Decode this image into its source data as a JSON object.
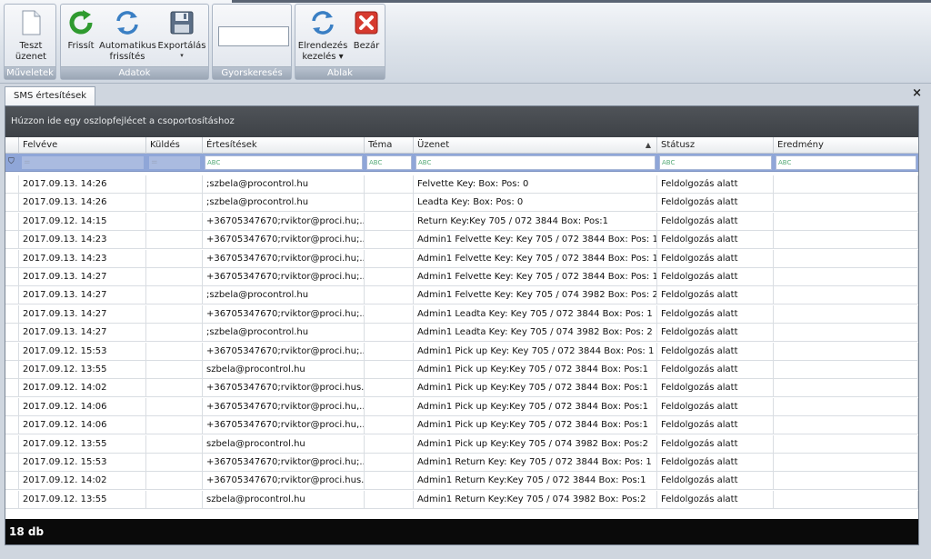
{
  "ribbon": {
    "groups": [
      {
        "label": "Műveletek",
        "buttons": [
          {
            "label_1": "Teszt",
            "label_2": "üzenet",
            "icon": "document-icon"
          }
        ]
      },
      {
        "label": "Adatok",
        "buttons": [
          {
            "label_1": "Frissít",
            "label_2": "",
            "icon": "refresh-icon"
          },
          {
            "label_1": "Automatikus",
            "label_2": "frissítés",
            "icon": "auto-refresh-icon"
          },
          {
            "label_1": "Exportálás",
            "label_2": "▾",
            "icon": "floppy-disk-icon"
          }
        ]
      },
      {
        "label": "Gyorskeresés",
        "search_value": ""
      },
      {
        "label": "Ablak",
        "buttons": [
          {
            "label_1": "Elrendezés",
            "label_2": "kezelés ▾",
            "icon": "layout-icon"
          },
          {
            "label_1": "Bezár",
            "label_2": "",
            "icon": "close-red-icon"
          }
        ]
      }
    ]
  },
  "tabs": [
    {
      "label": "SMS értesítések"
    }
  ],
  "tab_close": "×",
  "grid": {
    "group_panel_text": "Húzzon ide egy oszlopfejlécet a csoportosításhoz",
    "columns": [
      "Felvéve",
      "Küldés",
      "Értesítések",
      "Téma",
      "Üzenet",
      "Státusz",
      "Eredmény"
    ],
    "sort_indicator": "▲",
    "filter_row": {
      "Felvéve": "=",
      "Küldés": "=",
      "Értesítések": "ABC",
      "Téma": "ABC",
      "Üzenet": "ABC",
      "Státusz": "ABC",
      "Eredmény": "ABC"
    },
    "rows": [
      {
        "felveve": "2017.09.13. 14:26",
        "kuldes": "",
        "ertesitesek": ";szbela@procontrol.hu",
        "tema": "",
        "uzenet": "Felvette Key:  Box:  Pos: 0",
        "statusz": "Feldolgozás alatt",
        "eredmeny": ""
      },
      {
        "felveve": "2017.09.13. 14:26",
        "kuldes": "",
        "ertesitesek": ";szbela@procontrol.hu",
        "tema": "",
        "uzenet": "Leadta Key:  Box:  Pos: 0",
        "statusz": "Feldolgozás alatt",
        "eredmeny": ""
      },
      {
        "felveve": "2017.09.12. 14:15",
        "kuldes": "",
        "ertesitesek": "+36705347670;rviktor@proci.hu;...",
        "tema": "",
        "uzenet": "Return Key:Key 705 / 072 3844 Box: Pos:1",
        "statusz": "Feldolgozás alatt",
        "eredmeny": ""
      },
      {
        "felveve": "2017.09.13. 14:23",
        "kuldes": "",
        "ertesitesek": "+36705347670;rviktor@proci.hu;...",
        "tema": "",
        "uzenet": "Admin1 Felvette Key: Key 705 / 072 3844 Box:  Pos: 1",
        "statusz": "Feldolgozás alatt",
        "eredmeny": ""
      },
      {
        "felveve": "2017.09.13. 14:23",
        "kuldes": "",
        "ertesitesek": "+36705347670;rviktor@proci.hu;...",
        "tema": "",
        "uzenet": "Admin1 Felvette Key: Key 705 / 072 3844 Box:  Pos: 1",
        "statusz": "Feldolgozás alatt",
        "eredmeny": ""
      },
      {
        "felveve": "2017.09.13. 14:27",
        "kuldes": "",
        "ertesitesek": "+36705347670;rviktor@proci.hu;...",
        "tema": "",
        "uzenet": "Admin1 Felvette Key: Key 705 / 072 3844 Box:  Pos: 1",
        "statusz": "Feldolgozás alatt",
        "eredmeny": ""
      },
      {
        "felveve": "2017.09.13. 14:27",
        "kuldes": "",
        "ertesitesek": ";szbela@procontrol.hu",
        "tema": "",
        "uzenet": "Admin1 Felvette Key: Key 705 / 074 3982 Box:  Pos: 2",
        "statusz": "Feldolgozás alatt",
        "eredmeny": ""
      },
      {
        "felveve": "2017.09.13. 14:27",
        "kuldes": "",
        "ertesitesek": "+36705347670;rviktor@proci.hu;...",
        "tema": "",
        "uzenet": "Admin1 Leadta Key: Key 705 / 072 3844 Box:  Pos: 1",
        "statusz": "Feldolgozás alatt",
        "eredmeny": ""
      },
      {
        "felveve": "2017.09.13. 14:27",
        "kuldes": "",
        "ertesitesek": ";szbela@procontrol.hu",
        "tema": "",
        "uzenet": "Admin1 Leadta Key: Key 705 / 074 3982 Box:  Pos: 2",
        "statusz": "Feldolgozás alatt",
        "eredmeny": ""
      },
      {
        "felveve": "2017.09.12. 15:53",
        "kuldes": "",
        "ertesitesek": "+36705347670;rviktor@proci.hu;...",
        "tema": "",
        "uzenet": "Admin1 Pick up Key: Key 705 / 072 3844 Box:  Pos: 1",
        "statusz": "Feldolgozás alatt",
        "eredmeny": ""
      },
      {
        "felveve": "2017.09.12. 13:55",
        "kuldes": "",
        "ertesitesek": "szbela@procontrol.hu",
        "tema": "",
        "uzenet": "Admin1 Pick up Key:Key 705 / 072 3844 Box: Pos:1",
        "statusz": "Feldolgozás alatt",
        "eredmeny": ""
      },
      {
        "felveve": "2017.09.12. 14:02",
        "kuldes": "",
        "ertesitesek": "+36705347670;rviktor@proci.hus...",
        "tema": "",
        "uzenet": "Admin1 Pick up Key:Key 705 / 072 3844 Box: Pos:1",
        "statusz": "Feldolgozás alatt",
        "eredmeny": ""
      },
      {
        "felveve": "2017.09.12. 14:06",
        "kuldes": "",
        "ertesitesek": "+36705347670;rviktor@proci.hu,...",
        "tema": "",
        "uzenet": "Admin1 Pick up Key:Key 705 / 072 3844 Box: Pos:1",
        "statusz": "Feldolgozás alatt",
        "eredmeny": ""
      },
      {
        "felveve": "2017.09.12. 14:06",
        "kuldes": "",
        "ertesitesek": "+36705347670;rviktor@proci.hu,...",
        "tema": "",
        "uzenet": "Admin1 Pick up Key:Key 705 / 072 3844 Box: Pos:1",
        "statusz": "Feldolgozás alatt",
        "eredmeny": ""
      },
      {
        "felveve": "2017.09.12. 13:55",
        "kuldes": "",
        "ertesitesek": "szbela@procontrol.hu",
        "tema": "",
        "uzenet": "Admin1 Pick up Key:Key 705 / 074 3982 Box: Pos:2",
        "statusz": "Feldolgozás alatt",
        "eredmeny": ""
      },
      {
        "felveve": "2017.09.12. 15:53",
        "kuldes": "",
        "ertesitesek": "+36705347670;rviktor@proci.hu;...",
        "tema": "",
        "uzenet": "Admin1 Return Key: Key 705 / 072 3844 Box:  Pos: 1",
        "statusz": "Feldolgozás alatt",
        "eredmeny": ""
      },
      {
        "felveve": "2017.09.12. 14:02",
        "kuldes": "",
        "ertesitesek": "+36705347670;rviktor@proci.hus...",
        "tema": "",
        "uzenet": "Admin1 Return Key:Key 705 / 072 3844 Box: Pos:1",
        "statusz": "Feldolgozás alatt",
        "eredmeny": ""
      },
      {
        "felveve": "2017.09.12. 13:55",
        "kuldes": "",
        "ertesitesek": "szbela@procontrol.hu",
        "tema": "",
        "uzenet": "Admin1 Return Key:Key 705 / 074 3982 Box: Pos:2",
        "statusz": "Feldolgozás alatt",
        "eredmeny": ""
      }
    ],
    "footer_count": "18 db"
  }
}
